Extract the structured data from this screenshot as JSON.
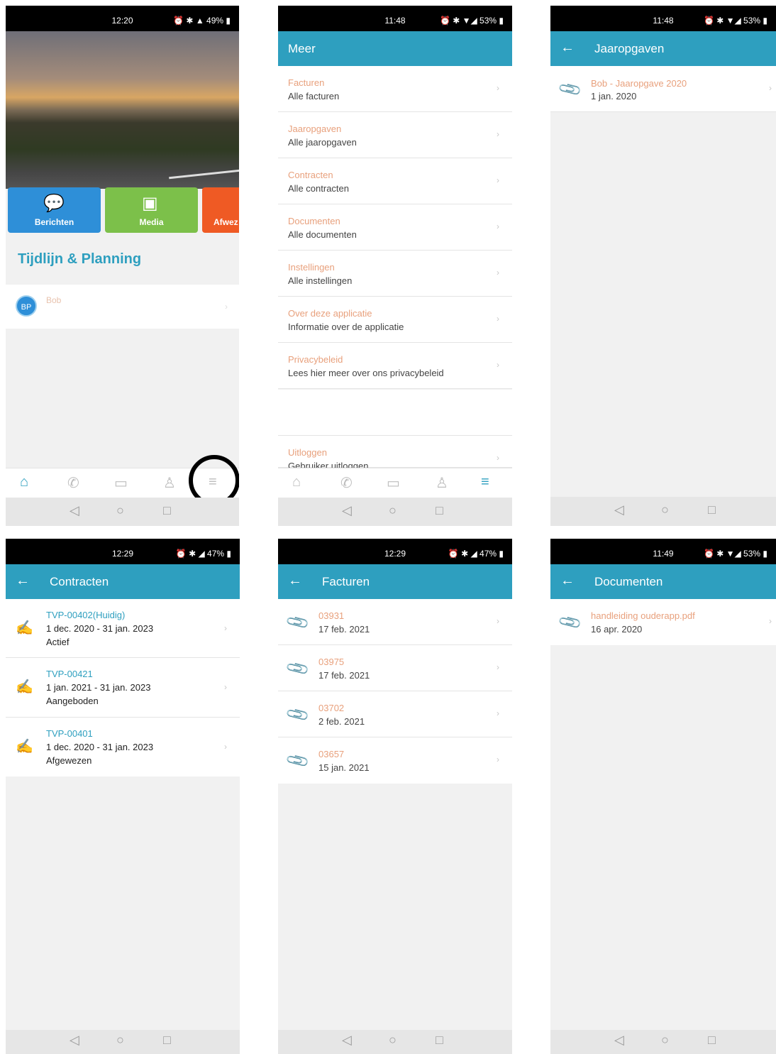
{
  "p1": {
    "time": "12:20",
    "status_icons": "⏰ ✱ ▲ 49% ▮",
    "tiles": [
      "Berichten",
      "Media",
      "Afwez"
    ],
    "heading": "Tijdlijn & Planning",
    "avatar": "BP",
    "name": "Bob"
  },
  "p2": {
    "time": "11:48",
    "status_icons": "⏰ ✱ ▼◢ 53% ▮",
    "title": "Meer",
    "items": [
      {
        "title": "Facturen",
        "sub": "Alle facturen"
      },
      {
        "title": "Jaaropgaven",
        "sub": "Alle jaaropgaven"
      },
      {
        "title": "Contracten",
        "sub": "Alle contracten"
      },
      {
        "title": "Documenten",
        "sub": "Alle documenten"
      },
      {
        "title": "Instellingen",
        "sub": "Alle instellingen"
      },
      {
        "title": "Over deze applicatie",
        "sub": "Informatie over de applicatie"
      },
      {
        "title": "Privacybeleid",
        "sub": "Lees hier meer over ons privacybeleid"
      }
    ],
    "logout": {
      "title": "Uitloggen",
      "sub": "Gebruiker uitloggen"
    }
  },
  "p3": {
    "time": "11:48",
    "status_icons": "⏰ ✱ ▼◢ 53% ▮",
    "title": "Jaaropgaven",
    "item": {
      "title": "Bob - Jaaropgave 2020",
      "date": "1 jan. 2020"
    }
  },
  "p4": {
    "time": "12:29",
    "status_icons": "⏰ ✱ ◢ 47% ▮",
    "title": "Contracten",
    "items": [
      {
        "id": "TVP-00402(Huidig)",
        "range": "1 dec. 2020 - 31 jan. 2023",
        "status": "Actief"
      },
      {
        "id": "TVP-00421",
        "range": "1 jan. 2021 - 31 jan. 2023",
        "status": "Aangeboden"
      },
      {
        "id": "TVP-00401",
        "range": "1 dec. 2020 - 31 jan. 2023",
        "status": "Afgewezen"
      }
    ]
  },
  "p5": {
    "time": "12:29",
    "status_icons": "⏰ ✱ ◢ 47% ▮",
    "title": "Facturen",
    "items": [
      {
        "num": "03931",
        "date": "17 feb. 2021"
      },
      {
        "num": "03975",
        "date": "17 feb. 2021"
      },
      {
        "num": "03702",
        "date": "2 feb. 2021"
      },
      {
        "num": "03657",
        "date": "15 jan. 2021"
      }
    ]
  },
  "p6": {
    "time": "11:49",
    "status_icons": "⏰ ✱ ▼◢ 53% ▮",
    "title": "Documenten",
    "item": {
      "title": "handleiding ouderapp.pdf",
      "date": "16 apr. 2020"
    }
  },
  "colors": {
    "accent": "#2e9fbf",
    "link": "#e8a07c",
    "tile_blue": "#2e8fd8",
    "tile_green": "#7cc04a",
    "tile_orange": "#ef5a24"
  }
}
